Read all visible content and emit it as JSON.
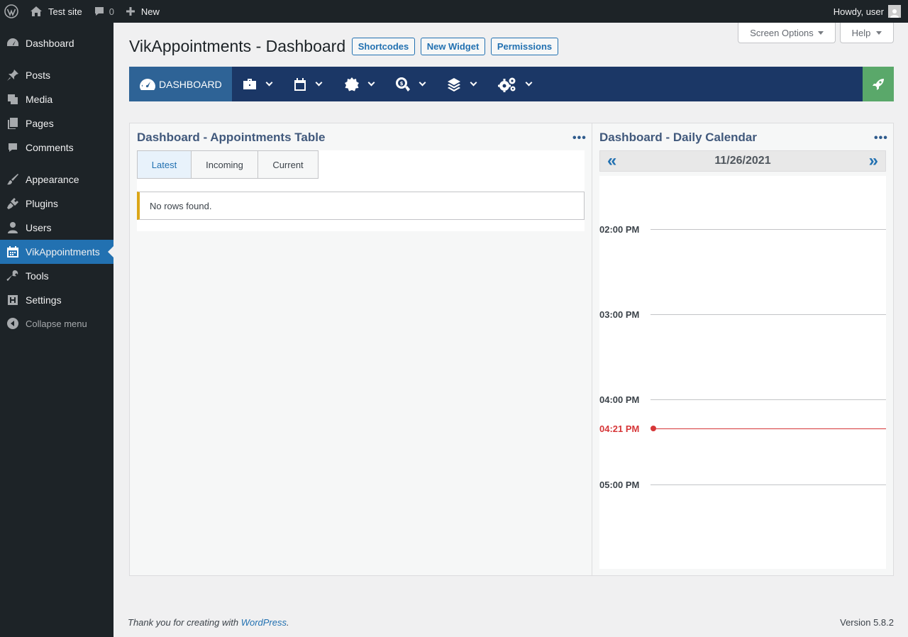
{
  "adminbar": {
    "site_name": "Test site",
    "comments_count": "0",
    "new_label": "New",
    "greeting": "Howdy, user"
  },
  "sidebar": {
    "items": [
      {
        "label": "Dashboard",
        "icon": "dashboard-icon"
      },
      {
        "label": "Posts",
        "icon": "pin-icon"
      },
      {
        "label": "Media",
        "icon": "media-icon"
      },
      {
        "label": "Pages",
        "icon": "pages-icon"
      },
      {
        "label": "Comments",
        "icon": "comment-icon"
      },
      {
        "label": "Appearance",
        "icon": "brush-icon"
      },
      {
        "label": "Plugins",
        "icon": "plug-icon"
      },
      {
        "label": "Users",
        "icon": "user-icon"
      },
      {
        "label": "VikAppointments",
        "icon": "calendar-icon"
      },
      {
        "label": "Tools",
        "icon": "wrench-icon"
      },
      {
        "label": "Settings",
        "icon": "settings-icon"
      }
    ],
    "collapse_label": "Collapse menu"
  },
  "screen_options": {
    "screen_options_label": "Screen Options",
    "help_label": "Help"
  },
  "page": {
    "title": "VikAppointments - Dashboard",
    "buttons": {
      "shortcodes": "Shortcodes",
      "new_widget": "New Widget",
      "permissions": "Permissions"
    }
  },
  "toolbar": {
    "dashboard_label": "DASHBOARD",
    "menus": [
      "briefcase-icon",
      "calendar-icon",
      "badge-icon",
      "search-dollar-icon",
      "layers-icon",
      "cogs-icon"
    ],
    "accent": "#1b3766",
    "rocket_color": "#5aa86a"
  },
  "widgets": {
    "appointments": {
      "title": "Dashboard - Appointments Table",
      "tabs": [
        "Latest",
        "Incoming",
        "Current"
      ],
      "active_tab": "Latest",
      "empty_message": "No rows found."
    },
    "calendar": {
      "title": "Dashboard - Daily Calendar",
      "date": "11/26/2021",
      "prev": "«",
      "next": "»",
      "hours": [
        "02:00 PM",
        "03:00 PM",
        "04:00 PM",
        "05:00 PM"
      ],
      "now": "04:21 PM",
      "now_color": "#d63638"
    }
  },
  "footer": {
    "thanks_prefix": "Thank you for creating with",
    "wp_link": "WordPress",
    "suffix": ".",
    "version": "Version 5.8.2"
  }
}
